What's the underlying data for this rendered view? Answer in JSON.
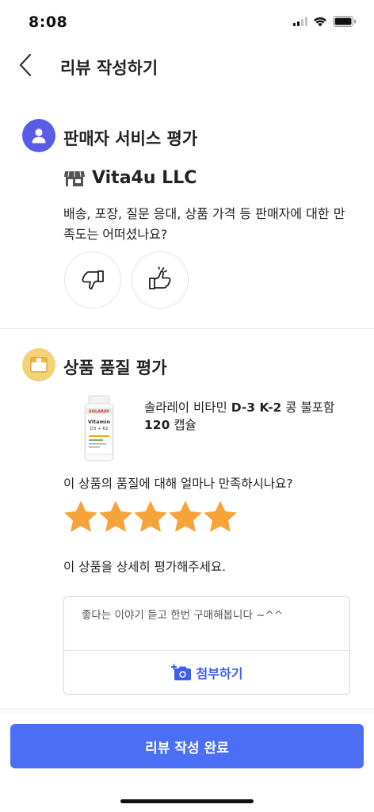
{
  "status_bar": {
    "time": "8:08"
  },
  "header": {
    "title": "리뷰 작성하기",
    "back_icon": "chevron-left-icon"
  },
  "seller_section": {
    "title": "판매자 서비스 평가",
    "icon": "person-icon",
    "icon_color": "#5b5ce6",
    "seller_icon": "store-icon",
    "seller_name": "Vita4u LLC",
    "question": "배송, 포장, 질문 응대, 상품 가격 등 판매자에 대한 만족도는 어떠셨나요?",
    "thumbs_down_icon": "thumbs-down-icon",
    "thumbs_up_icon": "thumbs-up-icon"
  },
  "product_section": {
    "title": "상품 품질 평가",
    "icon": "box-icon",
    "icon_color": "#f3d27a",
    "product_name_part1": "솔라레이 비타민 ",
    "product_name_bold1": "D-3 K-2",
    "product_name_part2": " 콩 불포함 ",
    "product_name_bold2": "120",
    "product_name_part3": " 캡슐",
    "product_image_icon": "vitamin-bottle-icon",
    "product_label_brand": "SOLARAY",
    "product_label_name": "Vitamin",
    "product_label_sub": "D3 + K2",
    "quality_question": "이 상품의 품질에 대해 얼마나 만족하시나요?",
    "rating": 5,
    "rating_max": 5,
    "star_color": "#f6a33a",
    "detail_label": "이 상품을 상세히 평가해주세요.",
    "review_text": "좋다는 이야기 듣고 한번 구매해봅니다 ~^^",
    "attach_icon": "camera-plus-icon",
    "attach_label": "첨부하기"
  },
  "footer": {
    "submit_label": "리뷰 작성 완료",
    "accent": "#4c6ef5"
  }
}
